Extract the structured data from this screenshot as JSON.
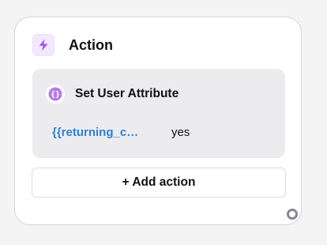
{
  "node": {
    "title": "Action",
    "icon": "lightning-bolt-icon",
    "accent_color": "#a855f7"
  },
  "attribute_action": {
    "title": "Set User Attribute",
    "icon": "braces-icon",
    "key": "{{returning_c…",
    "value": "yes",
    "key_color": "#2f80d8"
  },
  "add_action": {
    "label": "+ Add action"
  },
  "connector": {
    "icon": "output-handle-icon"
  }
}
